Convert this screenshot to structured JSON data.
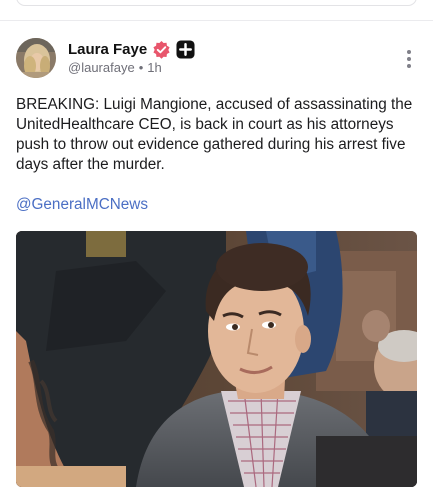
{
  "post": {
    "author_name": "Laura Faye",
    "handle": "@laurafaye",
    "separator": "•",
    "time_ago": "1h",
    "body": "BREAKING: Luigi Mangione, accused of assassinating the UnitedHealthcare CEO, is back in court as his attorneys push to throw out evidence gathered during his arrest five days after the murder.",
    "mention": "@GeneralMCNews",
    "icons": {
      "verified": "verified-badge-icon",
      "plus": "plus-badge-icon",
      "more": "more-options-icon"
    }
  },
  "colors": {
    "verified_badge": "#e8566c",
    "plus_badge": "#111111",
    "mention_link": "#4b6fc4",
    "handle_text": "#6f6f78"
  }
}
